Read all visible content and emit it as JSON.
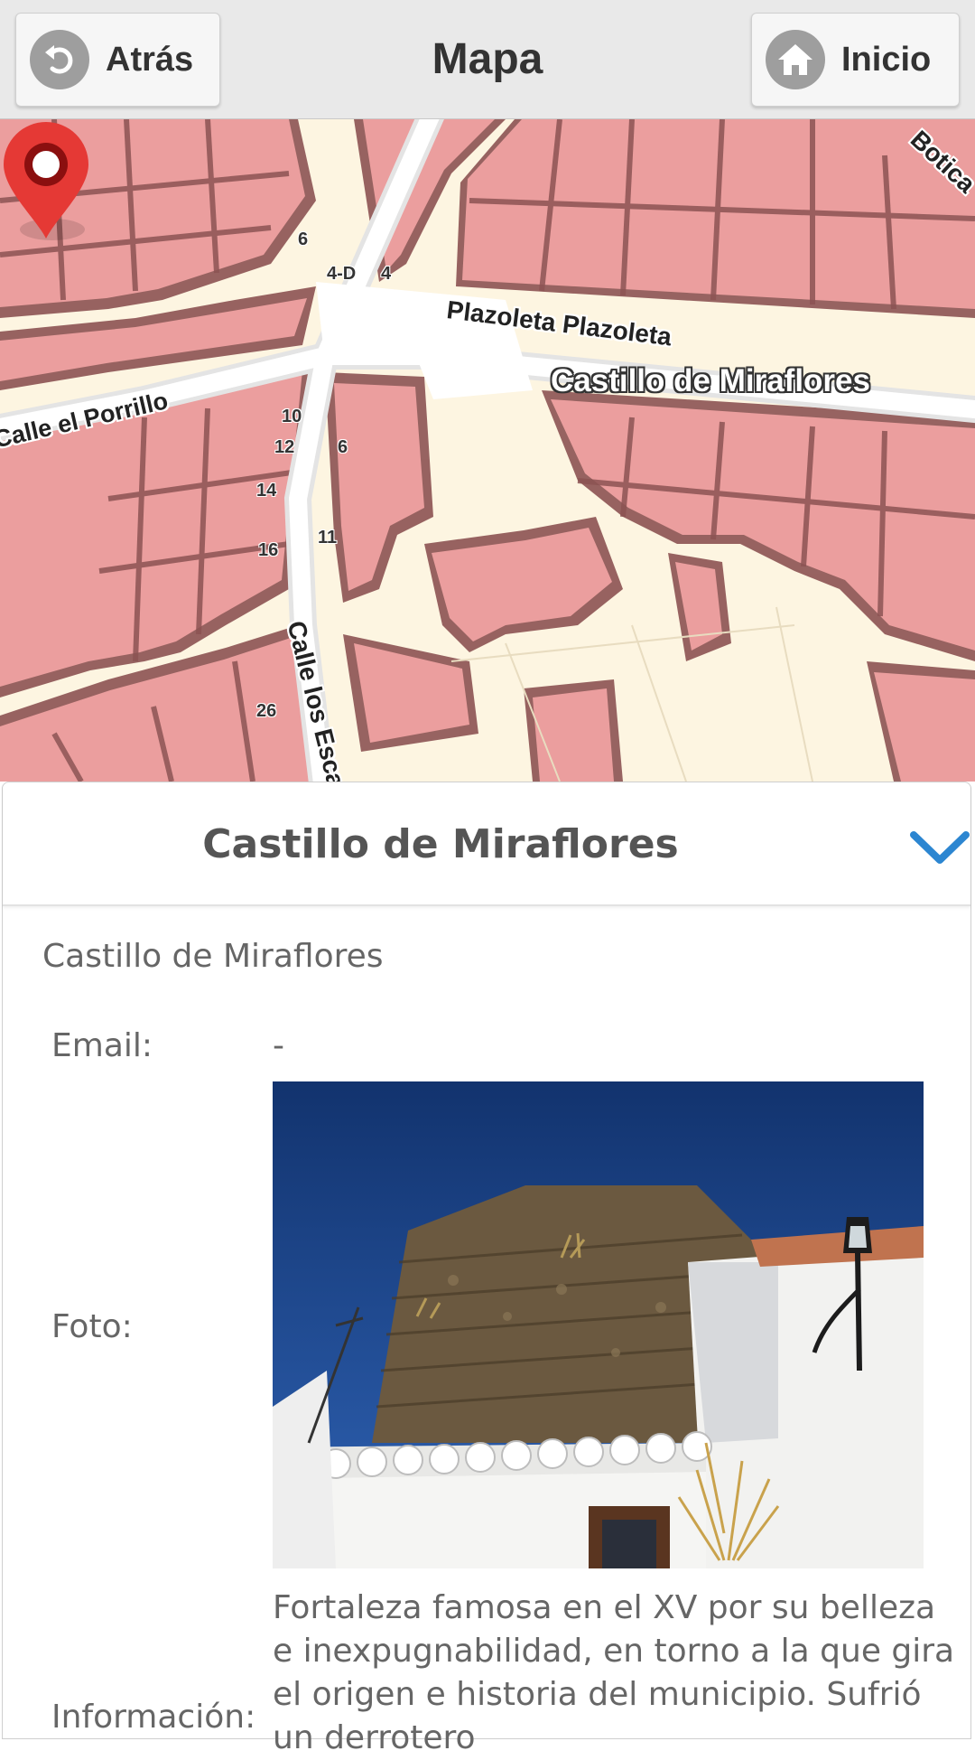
{
  "header": {
    "title": "Mapa",
    "back_label": "Atrás",
    "home_label": "Inicio",
    "back_icon": "back-arrow-icon",
    "home_icon": "home-icon"
  },
  "map": {
    "poi_label": "Castillo de Miraflores",
    "streets": [
      "Plazoleta Plazoleta",
      "Calle el Porrillo",
      "Calle los Escal",
      "Botica"
    ],
    "house_numbers": [
      "6",
      "4-D",
      "4",
      "10",
      "12",
      "6",
      "14",
      "16",
      "11",
      "26"
    ],
    "marker_icon": "map-pin-icon",
    "colors": {
      "building": "#eb9e9e",
      "building_shadow": "#8c5353",
      "ground": "#fdf5e1",
      "road": "#ffffff",
      "pin": "#e53935"
    }
  },
  "panel": {
    "title": "Castillo de Miraflores",
    "collapse_icon": "chevron-down-icon",
    "subtitle": "Castillo de Miraflores",
    "email_label": "Email:",
    "email_value": "-",
    "photo_label": "Foto:",
    "info_label": "Información:",
    "info_text": "Fortaleza famosa en el XV por su belleza e inexpugnabilidad, en torno a la que gira el origen e historia del municipio. Sufrió un derrotero"
  }
}
